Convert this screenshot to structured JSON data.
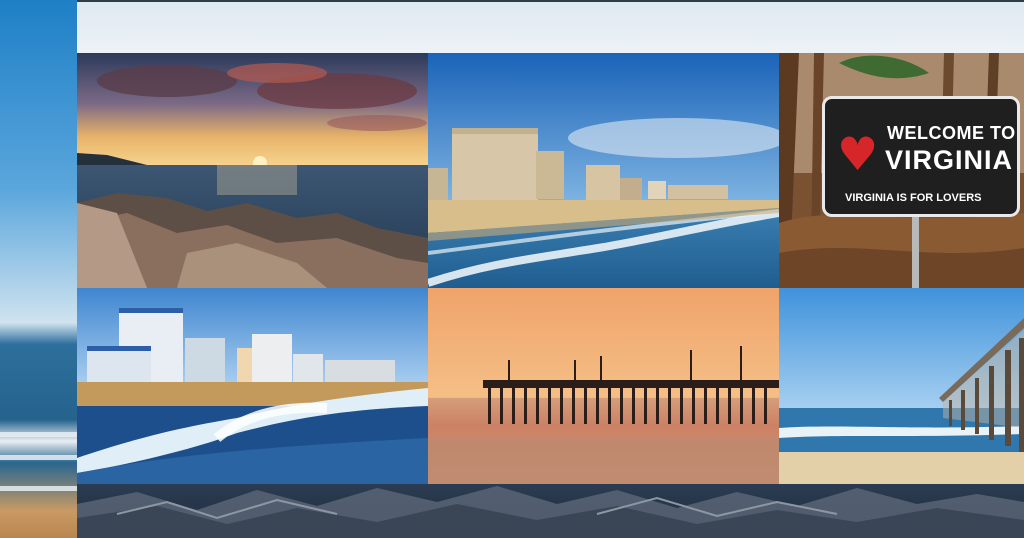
{
  "collage": {
    "tiles": [
      {
        "id": "rocky-sunset",
        "subject": "sunset-over-rocky-shore"
      },
      {
        "id": "beach-hotels",
        "subject": "oceanfront-hotels-and-surf"
      },
      {
        "id": "welcome-sign",
        "subject": "welcome-sign-in-woods"
      },
      {
        "id": "hotels-waves",
        "subject": "waves-and-beachfront-skyline"
      },
      {
        "id": "pier-sunset",
        "subject": "fishing-pier-at-dusk"
      },
      {
        "id": "pier-day",
        "subject": "wooden-pier-on-sunny-beach"
      }
    ]
  },
  "sign": {
    "line1": "WELCOME TO",
    "line2": "VIRGINIA",
    "line3": "VIRGINIA IS FOR LOVERS",
    "heart": "♥",
    "colors": {
      "panel": "#1f1f1f",
      "text": "#ffffff",
      "heart": "#d7262a",
      "border": "#e9e9e9"
    }
  }
}
